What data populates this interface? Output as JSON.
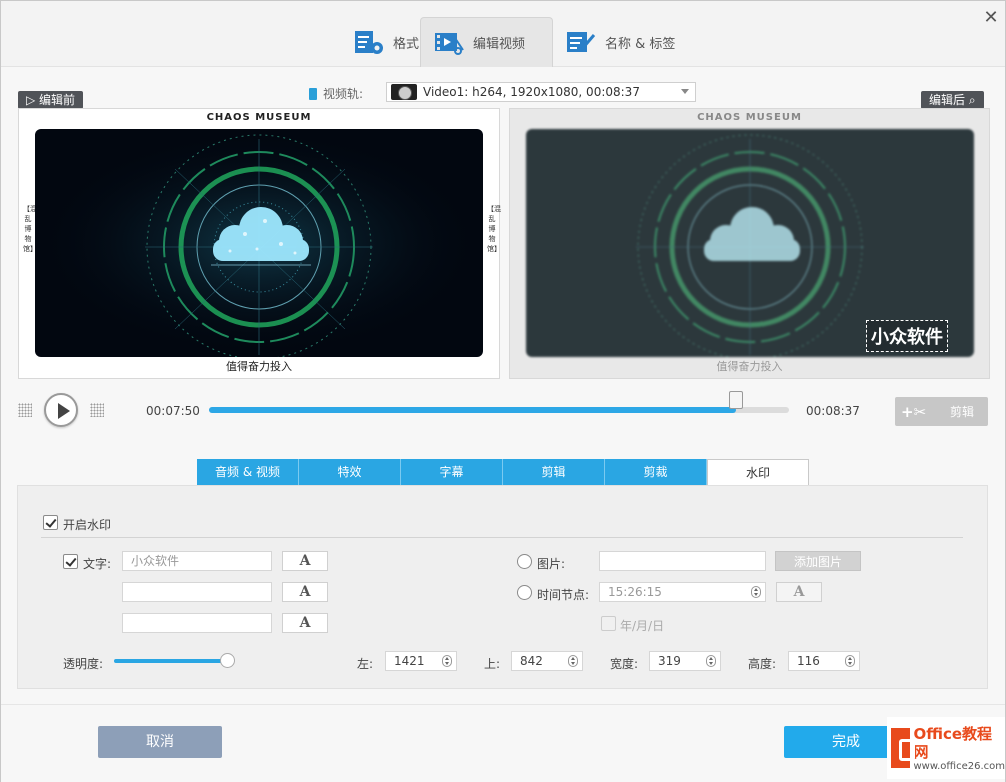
{
  "window": {
    "tabs": [
      {
        "label": "格式",
        "icon": "format-settings-icon"
      },
      {
        "label": "编辑视频",
        "icon": "edit-video-icon",
        "active": true
      },
      {
        "label": "名称 & 标签",
        "icon": "name-tag-icon"
      }
    ]
  },
  "track": {
    "label": "视频轨:",
    "selected": "Video1: h264, 1920x1080, 00:08:37"
  },
  "preview": {
    "before_label": "编辑前",
    "after_label": "编辑后",
    "video_title": "CHAOS MUSEUM",
    "caption": "值得奋力投入",
    "side_text": "【混乱博物馆】",
    "watermark_text": "小众软件"
  },
  "playback": {
    "current_time": "00:07:50",
    "total_time": "00:08:37",
    "progress_fraction": 0.908,
    "cut_label": "剪辑"
  },
  "subtabs": [
    {
      "label": "音频 & 视频"
    },
    {
      "label": "特效"
    },
    {
      "label": "字幕"
    },
    {
      "label": "剪辑"
    },
    {
      "label": "剪裁"
    },
    {
      "label": "水印",
      "active": true
    }
  ],
  "watermark": {
    "enable_label": "开启水印",
    "enabled": true,
    "text_label": "文字:",
    "text_checked": true,
    "text1": "小众软件",
    "text2": "",
    "text3": "",
    "a_button": "A",
    "image_label": "图片:",
    "add_image_label": "添加图片",
    "timestamp_label": "时间节点:",
    "timestamp_value": "15:26:15",
    "date_label": "年/月/日",
    "opacity_label": "透明度:",
    "opacity_fraction": 0.93,
    "left_label": "左:",
    "left_value": "1421",
    "top_label": "上:",
    "top_value": "842",
    "width_label": "宽度:",
    "width_value": "319",
    "height_label": "高度:",
    "height_value": "116"
  },
  "footer": {
    "cancel_label": "取消",
    "done_label": "完成"
  },
  "brand": {
    "name": "Office教程网",
    "url": "www.office26.com"
  },
  "colors": {
    "accent": "#2aa6e3",
    "done": "#22aaeb",
    "cancel": "#8d9fb8"
  }
}
